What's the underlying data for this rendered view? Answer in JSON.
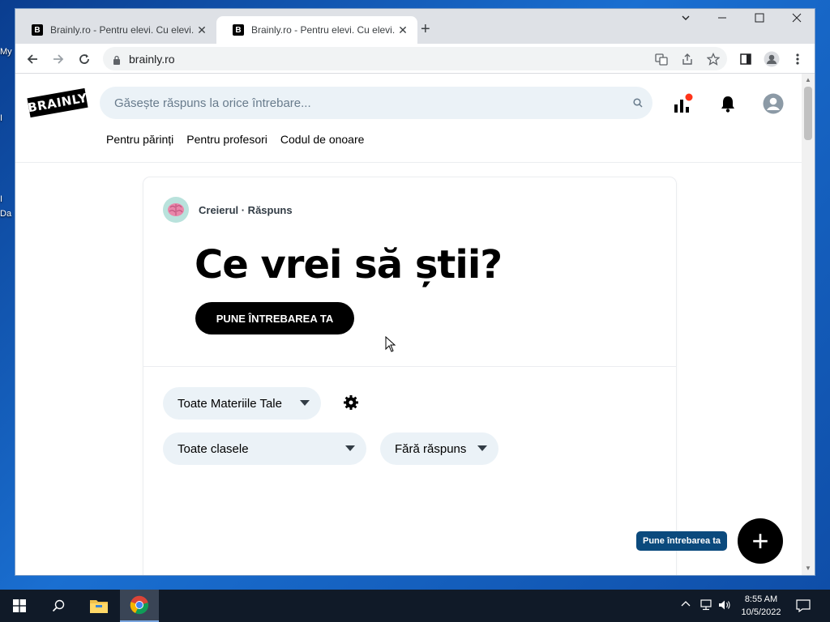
{
  "desktop": {
    "labels": [
      "My",
      "I",
      "I",
      "Da"
    ]
  },
  "browser": {
    "tabs": [
      {
        "title": "Brainly.ro - Pentru elevi. Cu elevi.",
        "active": false
      },
      {
        "title": "Brainly.ro - Pentru elevi. Cu elevi.",
        "active": true
      }
    ],
    "tab_favicon": "B",
    "new_tab_label": "+",
    "address": "brainly.ro"
  },
  "site": {
    "logo": "BRAINLY",
    "search_placeholder": "Găsește răspuns la orice întrebare...",
    "nav_links": [
      "Pentru părinți",
      "Pentru profesori",
      "Codul de onoare"
    ],
    "brand_label": "Creierul · Răspuns",
    "headline": "Ce vrei să știi?",
    "ask_button": "PUNE ÎNTREBAREA TA",
    "filters": {
      "subjects": "Toate Materiile Tale",
      "classes": "Toate clasele",
      "status": "Fără răspuns"
    },
    "fab_label": "Pune întrebarea ta",
    "fab_icon": "+",
    "notification_dot_color": "#ff341a"
  },
  "taskbar": {
    "time": "8:55 AM",
    "date": "10/5/2022"
  }
}
